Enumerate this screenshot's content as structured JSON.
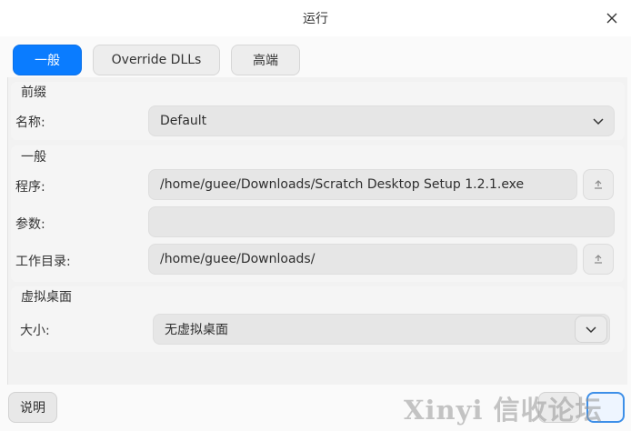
{
  "window": {
    "title": "运行"
  },
  "tabs": [
    {
      "label": "一般",
      "active": true
    },
    {
      "label": "Override DLLs",
      "active": false
    },
    {
      "label": "高端",
      "active": false
    }
  ],
  "prefix_section": {
    "title": "前缀",
    "name_label": "名称:",
    "name_value": "Default"
  },
  "general_section": {
    "title": "一般",
    "program_label": "程序:",
    "program_value": "/home/guee/Downloads/Scratch Desktop Setup 1.2.1.exe",
    "args_label": "参数:",
    "args_value": "",
    "workdir_label": "工作目录:",
    "workdir_value": "/home/guee/Downloads/"
  },
  "desktop_section": {
    "title": "虚拟桌面",
    "size_label": "大小:",
    "size_value": "无虚拟桌面"
  },
  "footer": {
    "help_label": "说明",
    "watermark": "Xinyi 信收论坛"
  },
  "colors": {
    "accent": "#0a7cff",
    "field_bg": "#e6e6e6",
    "panel_bg": "#f2f2f2"
  },
  "icons": {
    "close": "close-icon",
    "chevron": "chevron-down-icon",
    "browse": "upload-icon"
  }
}
